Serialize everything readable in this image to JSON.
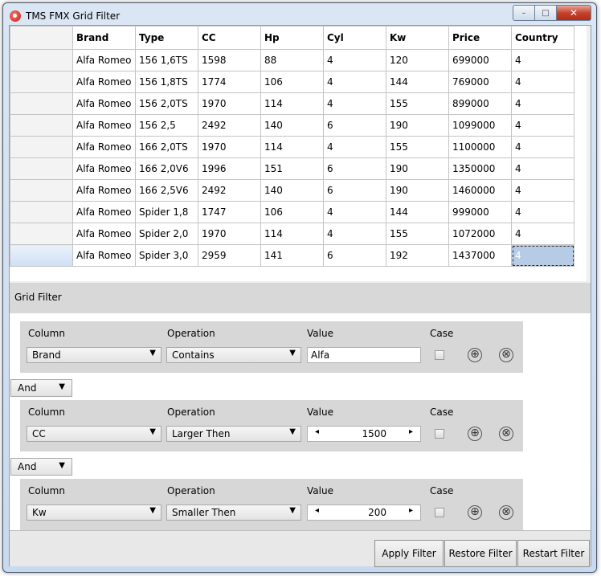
{
  "window": {
    "title": "TMS FMX Grid Filter",
    "min": "–",
    "max": "□",
    "close": "✕"
  },
  "grid": {
    "columns": [
      "Brand",
      "Type",
      "CC",
      "Hp",
      "Cyl",
      "Kw",
      "Price",
      "Country"
    ],
    "rows": [
      [
        "Alfa Romeo",
        "156 1,6TS",
        "1598",
        "88",
        "4",
        "120",
        "699000",
        "4"
      ],
      [
        "Alfa Romeo",
        "156 1,8TS",
        "1774",
        "106",
        "4",
        "144",
        "769000",
        "4"
      ],
      [
        "Alfa Romeo",
        "156 2,0TS",
        "1970",
        "114",
        "4",
        "155",
        "899000",
        "4"
      ],
      [
        "Alfa Romeo",
        "156 2,5",
        "2492",
        "140",
        "6",
        "190",
        "1099000",
        "4"
      ],
      [
        "Alfa Romeo",
        "166 2,0TS",
        "1970",
        "114",
        "4",
        "155",
        "1100000",
        "4"
      ],
      [
        "Alfa Romeo",
        "166 2,0V6",
        "1996",
        "151",
        "6",
        "190",
        "1350000",
        "4"
      ],
      [
        "Alfa Romeo",
        "166 2,5V6",
        "2492",
        "140",
        "6",
        "190",
        "1460000",
        "4"
      ],
      [
        "Alfa Romeo",
        "Spider 1,8",
        "1747",
        "106",
        "4",
        "144",
        "999000",
        "4"
      ],
      [
        "Alfa Romeo",
        "Spider 2,0",
        "1970",
        "114",
        "4",
        "155",
        "1072000",
        "4"
      ],
      [
        "Alfa Romeo",
        "Spider 3,0",
        "2959",
        "141",
        "6",
        "192",
        "1437000",
        "4"
      ]
    ]
  },
  "filter": {
    "header": "Grid Filter",
    "labels": {
      "column": "Column",
      "operation": "Operation",
      "value": "Value",
      "case": "Case"
    },
    "conditions": [
      {
        "column": "Brand",
        "operation": "Contains",
        "value": "Alfa"
      },
      {
        "column": "CC",
        "operation": "Larger Then",
        "value": "1500"
      },
      {
        "column": "Kw",
        "operation": "Smaller Then",
        "value": "200"
      }
    ],
    "connectors": [
      "And",
      "And"
    ],
    "icons": {
      "add": "⊕",
      "remove": "⊗",
      "dropdown": "▼",
      "spin_left": "◂",
      "spin_right": "▸"
    }
  },
  "buttons": {
    "apply": "Apply Filter",
    "restore": "Restore Filter",
    "restart": "Restart Filter"
  }
}
